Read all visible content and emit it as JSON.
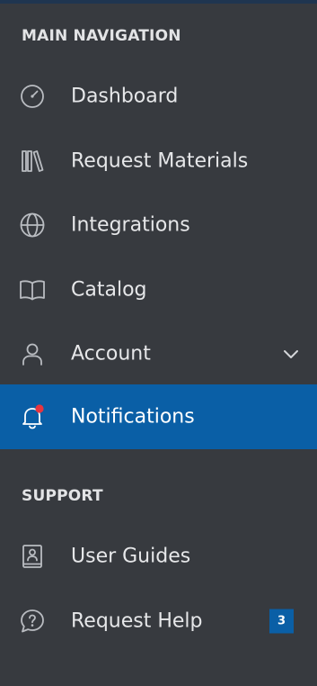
{
  "sidebar": {
    "main_header": "MAIN NAVIGATION",
    "support_header": "SUPPORT",
    "items": [
      {
        "label": "Dashboard",
        "icon": "dashboard-gauge-icon"
      },
      {
        "label": "Request Materials",
        "icon": "books-icon"
      },
      {
        "label": "Integrations",
        "icon": "globe-icon"
      },
      {
        "label": "Catalog",
        "icon": "open-book-icon"
      },
      {
        "label": "Account",
        "icon": "user-icon",
        "expandable": true
      },
      {
        "label": "Notifications",
        "icon": "bell-icon",
        "active": true,
        "unread_dot": true
      }
    ],
    "support_items": [
      {
        "label": "User Guides",
        "icon": "contact-book-icon"
      },
      {
        "label": "Request Help",
        "icon": "help-chat-icon",
        "badge": "3"
      }
    ]
  },
  "colors": {
    "background": "#373a3f",
    "active_background": "#0a5fa6",
    "badge_background": "#0a5fa6",
    "notification_dot": "#e8343f",
    "text": "#e6e7e9"
  }
}
